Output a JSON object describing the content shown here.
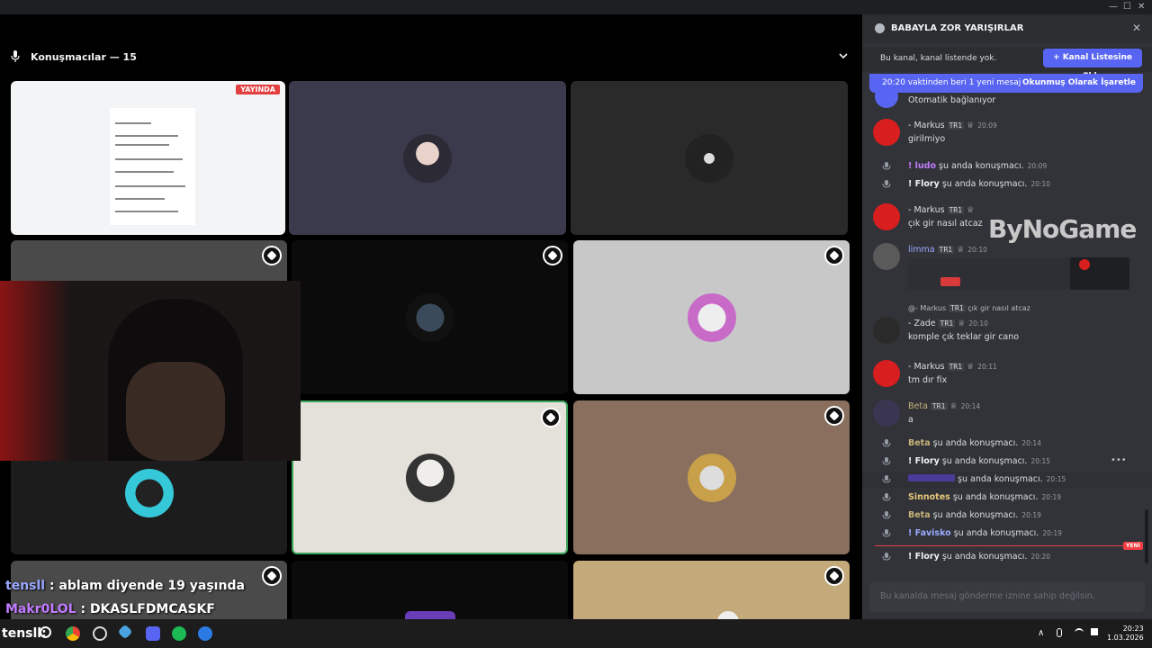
{
  "window": {
    "min": "—",
    "max": "☐",
    "close": "✕"
  },
  "stage": {
    "title": "Konuşmacılar — 15",
    "live_badge": "YAYINDA",
    "overlay_chat": [
      {
        "user": "tensll",
        "text": " : ablam diyende 19 yaşında"
      },
      {
        "user": "Makr0LOL",
        "text": " : DKASLFDMCASKF"
      }
    ],
    "taskbar_overlay": "tensll:"
  },
  "panel": {
    "channel_title": "BABAYLA ZOR YARIŞIRLAR",
    "notice_text": "Bu kanal, kanal listende yok.",
    "add_button": "Kanal Listesine Ekle",
    "new_messages": "20:20 vaktinden beri 1 yeni mesaj",
    "mark_read": "Okunmuş Olarak İşaretle",
    "watermark": "ByNoGame",
    "messages": [
      {
        "body": "Otomatik bağlanıyor"
      },
      {
        "user": "- Markus",
        "tag": "TR1",
        "time": "20:09",
        "body": "girilmiyo"
      },
      {
        "sys_user": "! ludo",
        "sys_text": " şu anda konuşmacı.",
        "time": "20:09"
      },
      {
        "sys_user": "! Flory",
        "sys_text": " şu anda konuşmacı.",
        "time": "20:10"
      },
      {
        "user": "- Markus",
        "tag": "TR1",
        "time": "",
        "body": "çık gir nasıl atcaz"
      },
      {
        "user": "limma",
        "tag": "TR1",
        "time": "20:10"
      },
      {
        "reply": "@- Markus",
        "reply_tag": "TR1",
        "reply_text": "çık gir nasıl atcaz",
        "user": "- Zade",
        "tag": "TR1",
        "time": "20:10",
        "body": "komple çık teklar gir cano"
      },
      {
        "user": "- Markus",
        "tag": "TR1",
        "time": "20:11",
        "body": "tm dır fix"
      },
      {
        "user": "Beta",
        "tag": "TR1",
        "time": "20:14",
        "body": "a"
      },
      {
        "sys_user": "Beta",
        "sys_text": " şu anda konuşmacı.",
        "time": "20:14"
      },
      {
        "sys_user": "! Flory",
        "sys_text": " şu anda konuşmacı.",
        "time": "20:15"
      },
      {
        "sys_user": "",
        "sys_text": " şu anda konuşmacı.",
        "time": "20:15"
      },
      {
        "sys_user": "Sinnotes",
        "sys_text": " şu anda konuşmacı.",
        "time": "20:19"
      },
      {
        "sys_user": "Beta",
        "sys_text": " şu anda konuşmacı.",
        "time": "20:19"
      },
      {
        "sys_user": "! Favisko",
        "sys_text": " şu anda konuşmacı.",
        "time": "20:19"
      },
      {
        "sys_user": "! Flory",
        "sys_text": " şu anda konuşmacı.",
        "time": "20:20"
      }
    ],
    "new_pill": "YENİ",
    "composer_placeholder": "Bu kanalda mesaj gönderme iznine sahip değilsin."
  },
  "taskbar": {
    "time": "20:23",
    "date": "1.03.2026",
    "tray_up": "∧"
  },
  "colors": {
    "accent": "#5865f2",
    "panel": "#313338",
    "danger": "#f23f43"
  }
}
